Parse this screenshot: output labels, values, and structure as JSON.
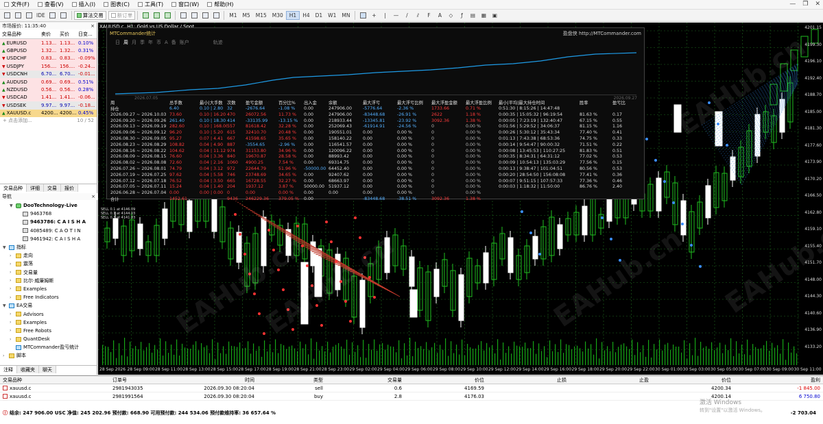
{
  "menu": [
    "文件(F)",
    "查看(V)",
    "插入(I)",
    "图表(C)",
    "工具(T)",
    "窗口(W)",
    "帮助(H)"
  ],
  "toolbar": {
    "algo_label": "算法交易",
    "neworder_label": "新订单",
    "ide_label": "IDE",
    "timeframes": [
      "M1",
      "M5",
      "M15",
      "M30",
      "H1",
      "H4",
      "D1",
      "W1",
      "MN"
    ],
    "active_tf": "H1"
  },
  "market_watch": {
    "title": "市场报价: 11:35:40",
    "headers": [
      "交易品种",
      "卖价",
      "买价",
      "日变..."
    ],
    "rows": [
      {
        "sym": "EURUSD",
        "bid": "1.13...",
        "ask": "1.13...",
        "chg": "0.10%",
        "style": "red",
        "dir": "pos"
      },
      {
        "sym": "GBPUSD",
        "bid": "1.32...",
        "ask": "1.32...",
        "chg": "0.31%",
        "style": "red",
        "dir": "pos"
      },
      {
        "sym": "USDCHF",
        "bid": "0.83...",
        "ask": "0.83...",
        "chg": "-0.09%",
        "style": "red",
        "dir": "neg"
      },
      {
        "sym": "USDJPY",
        "bid": "156....",
        "ask": "156....",
        "chg": "-0.24...",
        "style": "red",
        "dir": "neg"
      },
      {
        "sym": "USDCNH",
        "bid": "6.70...",
        "ask": "6.70...",
        "chg": "-0.01...",
        "style": "grey",
        "dir": "neg"
      },
      {
        "sym": "AUDUSD",
        "bid": "0.69...",
        "ask": "0.69...",
        "chg": "0.51%",
        "style": "red",
        "dir": "pos"
      },
      {
        "sym": "NZDUSD",
        "bid": "0.56...",
        "ask": "0.56...",
        "chg": "0.28%",
        "style": "red",
        "dir": "pos"
      },
      {
        "sym": "USDCAD",
        "bid": "1.41...",
        "ask": "1.41...",
        "chg": "-0.06...",
        "style": "red",
        "dir": "neg"
      },
      {
        "sym": "USDSEK",
        "bid": "9.97...",
        "ask": "9.97...",
        "chg": "-0.18...",
        "style": "grey",
        "dir": "neg"
      },
      {
        "sym": "XAUUSD.c",
        "bid": "4200...",
        "ask": "4200...",
        "chg": "0.45%",
        "style": "sel",
        "dir": "pos"
      }
    ],
    "add_label": "+ 点击添加...",
    "count": "10 / 52",
    "tabs": [
      "交易品种",
      "详细",
      "交易",
      "报价"
    ]
  },
  "navigator": {
    "title": "导航",
    "items": [
      {
        "lvl": 1,
        "label": "DooTechnology-Live",
        "icon": "green",
        "exp": "▼",
        "bold": true
      },
      {
        "lvl": 2,
        "label": "9463768",
        "icon": "acc"
      },
      {
        "lvl": 2,
        "label": "9463786: C A I S H A",
        "icon": "acc",
        "bold": true
      },
      {
        "lvl": 2,
        "label": "4085489: C A O T I N",
        "icon": "acc"
      },
      {
        "lvl": 2,
        "label": "9461942: C A I S H A",
        "icon": "acc"
      },
      {
        "lvl": 0,
        "label": "指标",
        "icon": "ind",
        "exp": "▼"
      },
      {
        "lvl": 1,
        "label": "走向",
        "icon": "folder",
        "exp": "›"
      },
      {
        "lvl": 1,
        "label": "震荡",
        "icon": "folder",
        "exp": "›"
      },
      {
        "lvl": 1,
        "label": "交易量",
        "icon": "folder",
        "exp": "›"
      },
      {
        "lvl": 1,
        "label": "比尔·威廉姆斯",
        "icon": "folder",
        "exp": "›"
      },
      {
        "lvl": 1,
        "label": "Examples",
        "icon": "folder",
        "exp": "›"
      },
      {
        "lvl": 1,
        "label": "Free Indicators",
        "icon": "folder",
        "exp": "›"
      },
      {
        "lvl": 0,
        "label": "EA交易",
        "icon": "ind",
        "exp": "▼"
      },
      {
        "lvl": 1,
        "label": "Advisors",
        "icon": "folder",
        "exp": "›"
      },
      {
        "lvl": 1,
        "label": "Examples",
        "icon": "folder",
        "exp": "›"
      },
      {
        "lvl": 1,
        "label": "Free Robots",
        "icon": "folder",
        "exp": "›"
      },
      {
        "lvl": 1,
        "label": "QuantDesk",
        "icon": "folder",
        "exp": "›"
      },
      {
        "lvl": 1,
        "label": "MTCommander盈亏统计",
        "icon": "ind"
      },
      {
        "lvl": 0,
        "label": "脚本",
        "icon": "folder",
        "exp": "›"
      }
    ],
    "tabs": [
      "注释",
      "收藏夹",
      "聊天"
    ]
  },
  "chart": {
    "title": "XAUUSD.c, H1: Gold vs US Dollar / Spot",
    "price_labels": [
      "4201.15",
      "4199.30",
      "4196.10",
      "4192.40",
      "4188.70",
      "4185.00",
      "4181.30",
      "4177.60",
      "4173.90",
      "4170.20",
      "4166.50",
      "4162.80",
      "4159.10",
      "4155.40",
      "4151.70",
      "4148.00",
      "4144.30",
      "4140.60",
      "4136.90",
      "4133.20"
    ],
    "time_labels": [
      "28 Sep 2026",
      "28 Sep 09:00",
      "28 Sep 11:00",
      "28 Sep 13:00",
      "28 Sep 15:00",
      "28 Sep 17:00",
      "28 Sep 19:00",
      "28 Sep 21:00",
      "28 Sep 23:00",
      "29 Sep 02:00",
      "29 Sep 04:00",
      "29 Sep 06:00",
      "29 Sep 08:00",
      "29 Sep 10:00",
      "29 Sep 12:00",
      "29 Sep 14:00",
      "29 Sep 16:00",
      "29 Sep 18:00",
      "29 Sep 20:00",
      "29 Sep 22:00",
      "30 Sep 01:00",
      "30 Sep 03:00",
      "30 Sep 05:00",
      "30 Sep 07:00",
      "30 Sep 09:00",
      "30 Sep 11:00"
    ],
    "sell_labels": [
      "SELL 0.1 at 4146.09",
      "SELL 0.1 at 4144.03",
      "SELL 0.1 at 4141.83"
    ],
    "watermark": "EAHub.cn"
  },
  "stats": {
    "title": "MTCommander统计",
    "link_label": "盈盘侠 http://MTCommander.com",
    "tabs": [
      "日",
      "周",
      "月",
      "季",
      "年",
      "币",
      "A",
      "备",
      "账户",
      "轨迹"
    ],
    "active_tab": "周",
    "date_start": "2026.07.05",
    "date_end": "2026.09.27",
    "headers": [
      "周",
      "总手数",
      "最小|大手数",
      "次数",
      "盈亏金额",
      "百分比%",
      "出入金",
      "余额",
      "最大浮亏",
      "最大浮亏比例",
      "最大浮盈金额",
      "最大浮盈比例",
      "最小|平均|最大持仓时间",
      "胜率",
      "盈亏比"
    ],
    "rows": [
      [
        "持仓",
        "6.40",
        "0.10 | 2.80",
        "32",
        "-2676.64",
        "-1.08 %",
        "0.00",
        "247906.00",
        "-5776.64",
        "-2.36 %",
        "1733.66",
        "0.71 %",
        "0:51:30 | 8:15:26 | 14:47:48",
        "",
        ""
      ],
      [
        "2026.09.27 ~ 2026.10.03",
        "73.60",
        "0.10 | 16.20",
        "470",
        "26072.56",
        "11.73 %",
        "0.00",
        "247906.00",
        "-83448.68",
        "-26.91 %",
        "2622",
        "1.18 %",
        "0:00:35 | 15:05:32 | 96:19:54",
        "81.63 %",
        "0.17"
      ],
      [
        "2026.09.20 ~ 2026.09.26",
        "261.40",
        "0.10 | 18.30",
        "414",
        "-33135.99",
        "-13.15 %",
        "0.00",
        "218933.44",
        "-13345.81",
        "-23.92 %",
        "3092.36",
        "1.38 %",
        "0:00:05 | 7:23:19 | 132:40:47",
        "67.15 %",
        "0.55"
      ],
      [
        "2026.09.13 ~ 2026.09.19",
        "282.60",
        "0.10 | 168.00",
        "557",
        "81618.42",
        "32.28 %",
        "0.00",
        "252069.43",
        "-61914.91",
        "-24.56 %",
        "0",
        "0.00 %",
        "0:01:56 | 5:29:52 | 34:06:37",
        "81.15 %",
        "1.16"
      ],
      [
        "2026.09.06 ~ 2026.09.12",
        "96.20",
        "0.10 | 5.20",
        "615",
        "32410.70",
        "20.48 %",
        "0.00",
        "190551.01",
        "0.00",
        "0.00 %",
        "0",
        "0.00 %",
        "0:00:26 | 5:30:12 | 35:43:34",
        "77.40 %",
        "0.41"
      ],
      [
        "2026.08.30 ~ 2026.09.05",
        "95.27",
        "0.07 | 4.41",
        "667",
        "41598.65",
        "35.65 %",
        "0.00",
        "158140.22",
        "0.00",
        "0.00 %",
        "0",
        "0.00 %",
        "0:01:13 | 7:43:38 | 68:53:36",
        "74.75 %",
        "0.33"
      ],
      [
        "2026.08.23 ~ 2026.08.29",
        "108.82",
        "0.04 | 4.90",
        "887",
        "-3554.65",
        "-2.96 %",
        "0.00",
        "116541.57",
        "0.00",
        "0.00 %",
        "0",
        "0.00 %",
        "0:00:14 | 9:54:47 | 90:00:32",
        "71.51 %",
        "0.22"
      ],
      [
        "2026.08.16 ~ 2026.08.22",
        "104.62",
        "0.04 | 11.12",
        "974",
        "31153.80",
        "34.96 %",
        "0.00",
        "120096.22",
        "0.00",
        "0.00 %",
        "0",
        "0.00 %",
        "0:00:08 | 13:45:53 | 110:27:25",
        "81.83 %",
        "0.51"
      ],
      [
        "2026.08.09 ~ 2026.08.15",
        "76.60",
        "0.04 | 3.36",
        "840",
        "19670.87",
        "28.58 %",
        "0.00",
        "88993.42",
        "0.00",
        "0.00 %",
        "0",
        "0.00 %",
        "0:00:35 | 8:34:31 | 64:31:12",
        "77.02 %",
        "0.53"
      ],
      [
        "2026.08.02 ~ 2026.08.08",
        "72.60",
        "0.04 | 2.16",
        "1060",
        "4900.25",
        "7.54 %",
        "0.00",
        "69314.75",
        "0.00",
        "0.00 %",
        "0",
        "0.00 %",
        "0:00:09 | 10:54:13 | 135:03:29",
        "77.56 %",
        "0.15"
      ],
      [
        "2026.07.26 ~ 2026.08.01",
        "74.79",
        "0.04 | 3.12",
        "972",
        "22644.79",
        "51.96 %",
        "-50000.00",
        "64452.40",
        "0.00",
        "0.00 %",
        "0",
        "0.00 %",
        "0:00:13 | 9:38:47 | 101:04:51",
        "80.56 %",
        "0.53"
      ],
      [
        "2026.07.19 ~ 2026.07.25",
        "97.62",
        "0.04 | 5.58",
        "746",
        "23748.69",
        "34.65 %",
        "0.00",
        "92407.62",
        "0.00",
        "0.00 %",
        "0",
        "0.00 %",
        "0:00:20 | 28:54:50 | 156:08:08",
        "77.41 %",
        "0.36"
      ],
      [
        "2026.07.12 ~ 2026.07.18",
        "76.52",
        "0.04 | 3.50",
        "665",
        "16728.55",
        "32.27 %",
        "0.00",
        "68663.97",
        "0.00",
        "0.00 %",
        "0",
        "0.00 %",
        "0:00:07 | 9:51:15 | 107:57:33",
        "77.36 %",
        "0.46"
      ],
      [
        "2026.07.05 ~ 2026.07.11",
        "15.24",
        "0.04 | 1.40",
        "204",
        "1937.12",
        "3.87 %",
        "50000.00",
        "51937.12",
        "0.00",
        "0.00 %",
        "0",
        "0.00 %",
        "0:00:03 | 1:18:32 | 11:50:00",
        "86.76 %",
        "2.40"
      ],
      [
        "2026.06.28 ~ 2026.07.04",
        "0.00",
        "0.00 | 0.00",
        "0",
        "0.00",
        "0.00 %",
        "0.00",
        "0.00",
        "0.00",
        "0.00 %",
        "0",
        "0.00 %",
        "",
        "",
        ""
      ],
      [
        "合计",
        "1452.61",
        "",
        "9436",
        "246229.36",
        "379.05 %",
        "0.00",
        "",
        "-83448.68",
        "-38.51 %",
        "3092.36",
        "1.38 %",
        "",
        "",
        ""
      ]
    ]
  },
  "orders": {
    "headers": [
      "交易品种",
      "订单号",
      "时间",
      "类型",
      "交易量",
      "价位",
      "止损",
      "止盈",
      "价位",
      "盈利"
    ],
    "rows": [
      [
        "xauusd.c",
        "2981943035",
        "2026.09.30 08:20:04",
        "sell",
        "0.6",
        "4169.59",
        "",
        "",
        "4200.34",
        "-1 845.00"
      ],
      [
        "xauusd.c",
        "2981991564",
        "2026.09.30 08:20:04",
        "buy",
        "2.8",
        "4176.03",
        "",
        "",
        "4200.14",
        "6 750.80"
      ]
    ],
    "balance": "结余: 247 906.00 USC  净值: 245 202.96  预付款: 668.90  可用预付款: 244 534.06  预付款维持率: 36 657.64 %",
    "total": "-2 703.04"
  },
  "windows_wm": "激活 Windows",
  "windows_wm2": "转到\"设置\"以激活 Windows。",
  "colors": {
    "bull": "#1fbf1f",
    "bear": "#ffffff",
    "grid": "#1f6a1f",
    "curve": "#1e9be6"
  }
}
